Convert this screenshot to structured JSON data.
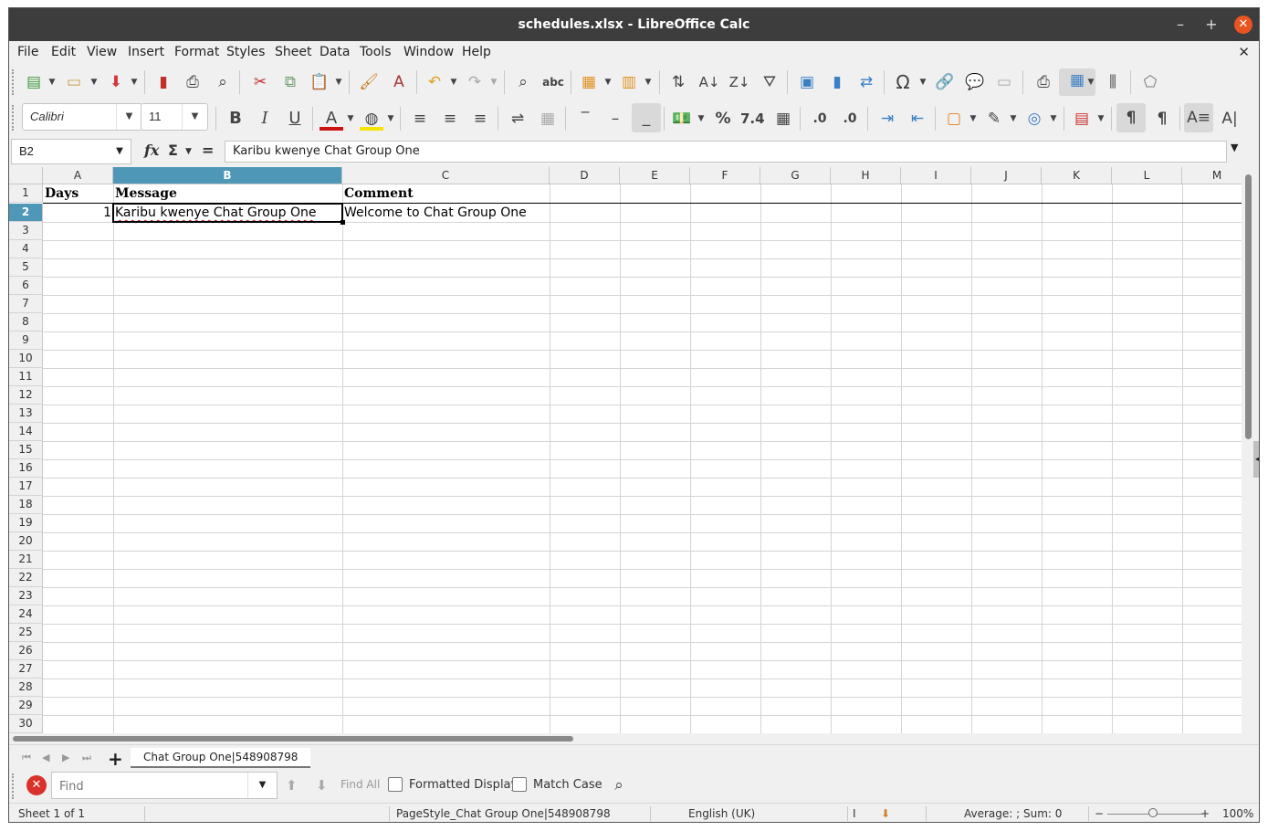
{
  "window": {
    "title": "schedules.xlsx - LibreOffice Calc"
  },
  "menu": [
    "File",
    "Edit",
    "View",
    "Insert",
    "Format",
    "Styles",
    "Sheet",
    "Data",
    "Tools",
    "Window",
    "Help"
  ],
  "font": {
    "name": "Calibri",
    "size": "11"
  },
  "formula_bar": {
    "cell_ref": "B2",
    "content": "Karibu kwenye Chat Group One"
  },
  "columns": [
    "A",
    "B",
    "C",
    "D",
    "E",
    "F",
    "G",
    "H",
    "I",
    "J",
    "K",
    "L",
    "M"
  ],
  "selected_column": "B",
  "rows": [
    "1",
    "2",
    "3",
    "4",
    "5",
    "6",
    "7",
    "8",
    "9",
    "10",
    "11",
    "12",
    "13",
    "14",
    "15",
    "16",
    "17",
    "18",
    "19",
    "20",
    "21",
    "22",
    "23",
    "24",
    "25",
    "26",
    "27",
    "28",
    "29",
    "30"
  ],
  "selected_row": "2",
  "cells": {
    "A1": "Days",
    "B1": "Message",
    "C1": "Comment",
    "A2": "1",
    "B2": "Karibu kwenye Chat Group One",
    "C2": "Welcome to Chat Group One"
  },
  "sheet_tab": "Chat Group One|548908798",
  "find": {
    "placeholder": "Find",
    "find_all": "Find All",
    "formatted_display": "Formatted Display",
    "match_case": "Match Case"
  },
  "status": {
    "sheet": "Sheet 1 of 1",
    "page_style": "PageStyle_Chat Group One|548908798",
    "language": "English (UK)",
    "selection_stats": "Average: ; Sum: 0",
    "zoom": "100%"
  },
  "colors": {
    "selection_header": "#4f97b7",
    "titlebar": "#3d3d3d",
    "close_button": "#e95420"
  }
}
